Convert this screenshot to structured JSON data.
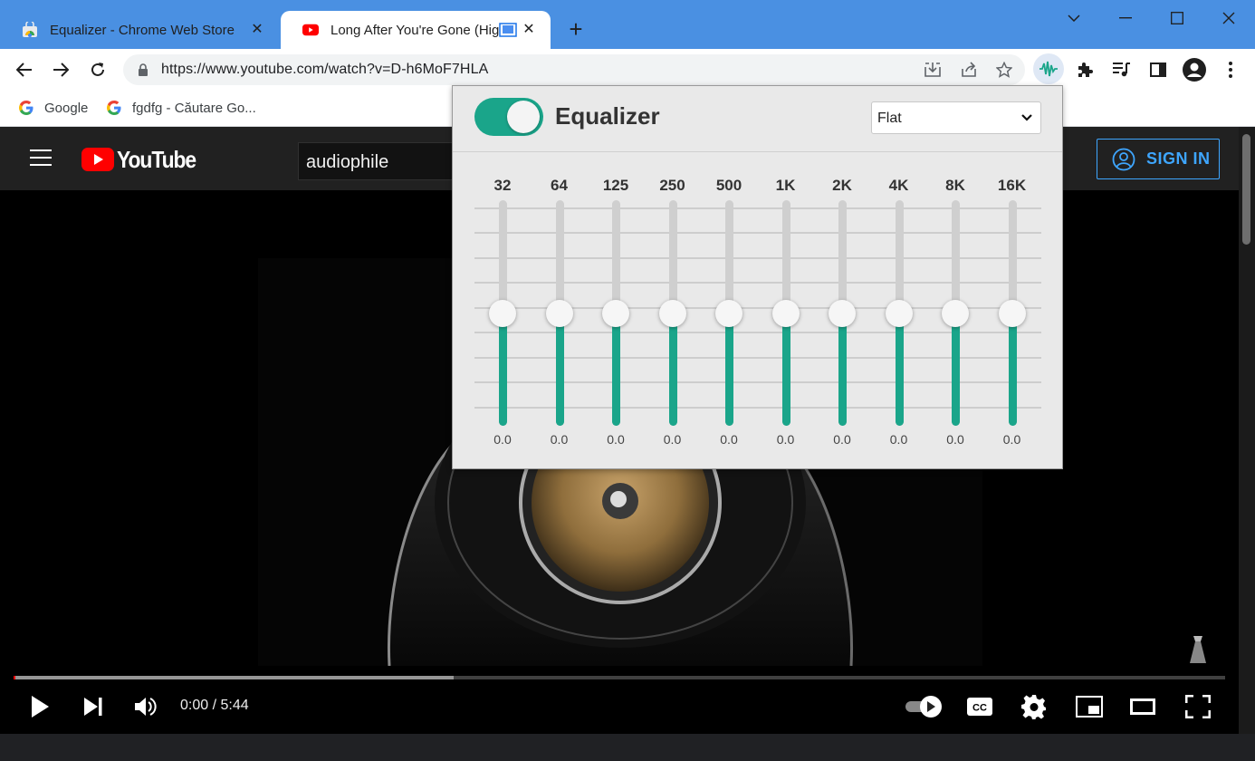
{
  "tabs": [
    {
      "title": "Equalizer - Chrome Web Store",
      "favicon": "chrome-web-store-icon",
      "active": false
    },
    {
      "title": "Long After You're Gone (High",
      "favicon": "youtube-icon",
      "active": true
    }
  ],
  "toolbar": {
    "url": "https://www.youtube.com/watch?v=D-h6MoF7HLA"
  },
  "bookmarks": [
    {
      "label": "Google",
      "icon": "google-icon"
    },
    {
      "label": "fgdfg - Căutare Go...",
      "icon": "google-icon"
    }
  ],
  "youtube": {
    "logo_text": "YouTube",
    "search_value": "audiophile",
    "sign_in_label": "SIGN IN",
    "time": "0:00 / 5:44",
    "buffered_fraction": 0.363,
    "played_fraction": 0.0
  },
  "equalizer": {
    "title": "Equalizer",
    "enabled": true,
    "preset": "Flat",
    "accent_color": "#1aa58a",
    "bands": [
      {
        "label": "32",
        "value": "0.0"
      },
      {
        "label": "64",
        "value": "0.0"
      },
      {
        "label": "125",
        "value": "0.0"
      },
      {
        "label": "250",
        "value": "0.0"
      },
      {
        "label": "500",
        "value": "0.0"
      },
      {
        "label": "1K",
        "value": "0.0"
      },
      {
        "label": "2K",
        "value": "0.0"
      },
      {
        "label": "4K",
        "value": "0.0"
      },
      {
        "label": "8K",
        "value": "0.0"
      },
      {
        "label": "16K",
        "value": "0.0"
      }
    ],
    "gain_range": [
      -12,
      12
    ]
  }
}
